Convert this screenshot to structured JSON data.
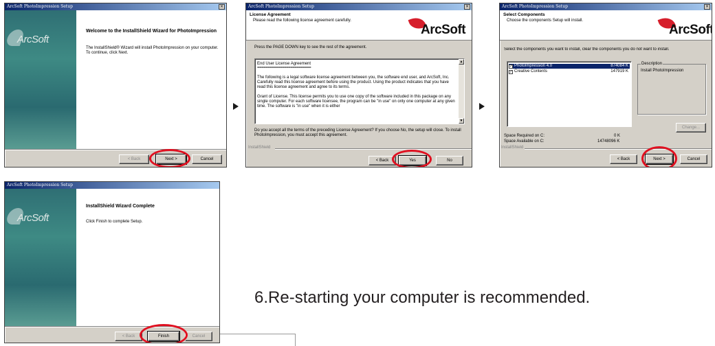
{
  "window_title": "ArcSoft PhotoImpression Setup",
  "close_glyph": "×",
  "brand": {
    "logo_text": "ArcSoft",
    "accent_red": "#e01020",
    "title_blue": "#0a246a"
  },
  "welcome": {
    "heading": "Welcome to the InstallShield Wizard for PhotoImpression",
    "body": "The InstallShield® Wizard will install PhotoImpression on your computer.  To continue, click Next.",
    "buttons": {
      "back": "< Back",
      "next": "Next >",
      "cancel": "Cancel"
    }
  },
  "license": {
    "title": "License Agreement",
    "subtitle": "Please read the following license agreement carefully.",
    "instruction": "Press the PAGE DOWN key to see the rest of the agreement.",
    "eula_heading": "End User License Agreement",
    "eula_rule": "==========================",
    "eula_p1": "The following is a legal software license agreement between you, the software end user, and ArcSoft, Inc.  Carefully read this license agreement before using the product.  Using the product indicates that you have read this license agreement and agree to its terms.",
    "eula_p2": "Grant of License. This license permits you to use one copy of the software included in this package on any single computer. For each software licensee, the program can be \"in use\" on only one computer at any given time. The software is \"in use\" when it is either",
    "question": "Do you accept all the terms of the preceding License Agreement?  If you choose No,  the setup will close.  To install PhotoImpression, you must accept this agreement.",
    "installshield": "InstallShield",
    "buttons": {
      "back": "< Back",
      "yes": "Yes",
      "no": "No"
    }
  },
  "select": {
    "title": "Select Components",
    "subtitle": "Choose the components Setup will install.",
    "instruction": "Select the components you want to install, clear the components you do not want to install.",
    "components": [
      {
        "name": "PhotoImpression 4.0",
        "size": "874084 K",
        "checked": true,
        "selected": true
      },
      {
        "name": "Creative Contents",
        "size": "147919 K",
        "checked": true,
        "selected": false
      }
    ],
    "description_label": "Description",
    "description_text": "Install PhotoImpression",
    "change_button": "Change...",
    "space_required_label": "Space Required on  C:",
    "space_required_value": "0 K",
    "space_available_label": "Space Available on  C:",
    "space_available_value": "14748096 K",
    "installshield": "InstallShield",
    "buttons": {
      "back": "< Back",
      "next": "Next >",
      "cancel": "Cancel"
    }
  },
  "complete": {
    "heading": "InstallShield Wizard Complete",
    "body": "Click Finish to complete Setup.",
    "buttons": {
      "back": "< Back",
      "finish": "Finish",
      "cancel": "Cancel"
    }
  },
  "caption": "6.Re-starting your computer is recommended."
}
